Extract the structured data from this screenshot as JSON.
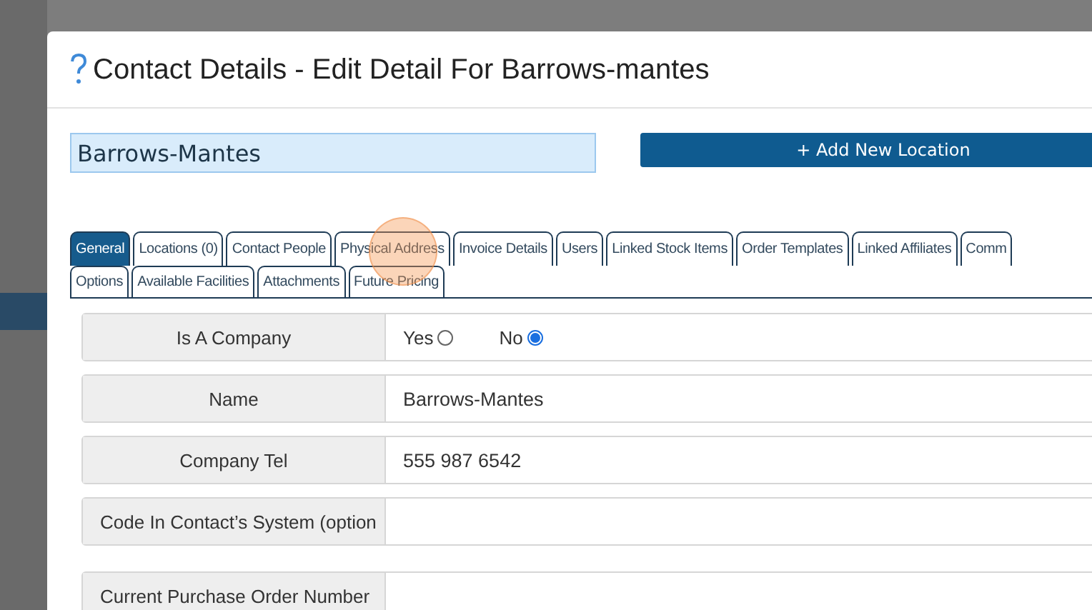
{
  "dialog": {
    "title": "Contact Details - Edit Detail For Barrows-mantes"
  },
  "name_field": {
    "value": "Barrows-Mantes"
  },
  "add_location_button": {
    "label": "+ Add New Location"
  },
  "tabs": [
    [
      {
        "label": "General",
        "selected": true
      },
      {
        "label": "Locations (0)",
        "selected": false
      },
      {
        "label": "Contact People",
        "selected": false
      },
      {
        "label": "Physical Address",
        "selected": false
      },
      {
        "label": "Invoice Details",
        "selected": false
      },
      {
        "label": "Users",
        "selected": false
      },
      {
        "label": "Linked Stock Items",
        "selected": false
      },
      {
        "label": "Order Templates",
        "selected": false
      },
      {
        "label": "Linked Affiliates",
        "selected": false
      },
      {
        "label": "Comm",
        "selected": false
      }
    ],
    [
      {
        "label": "Options",
        "selected": false
      },
      {
        "label": "Available Facilities",
        "selected": false
      },
      {
        "label": "Attachments",
        "selected": false
      },
      {
        "label": "Future Pricing",
        "selected": false
      }
    ]
  ],
  "form_rows": [
    {
      "kind": "radio",
      "label": "Is A Company",
      "options": [
        {
          "label": "Yes",
          "selected": false
        },
        {
          "label": "No",
          "selected": true
        }
      ]
    },
    {
      "kind": "text",
      "label": "Name",
      "value": "Barrows-Mantes"
    },
    {
      "kind": "text",
      "label": "Company Tel",
      "value": "555 987 6542"
    },
    {
      "kind": "text",
      "label": "Code In Contact’s System (option"
    },
    {
      "kind": "text",
      "label": "Current Purchase Order Number"
    }
  ]
}
